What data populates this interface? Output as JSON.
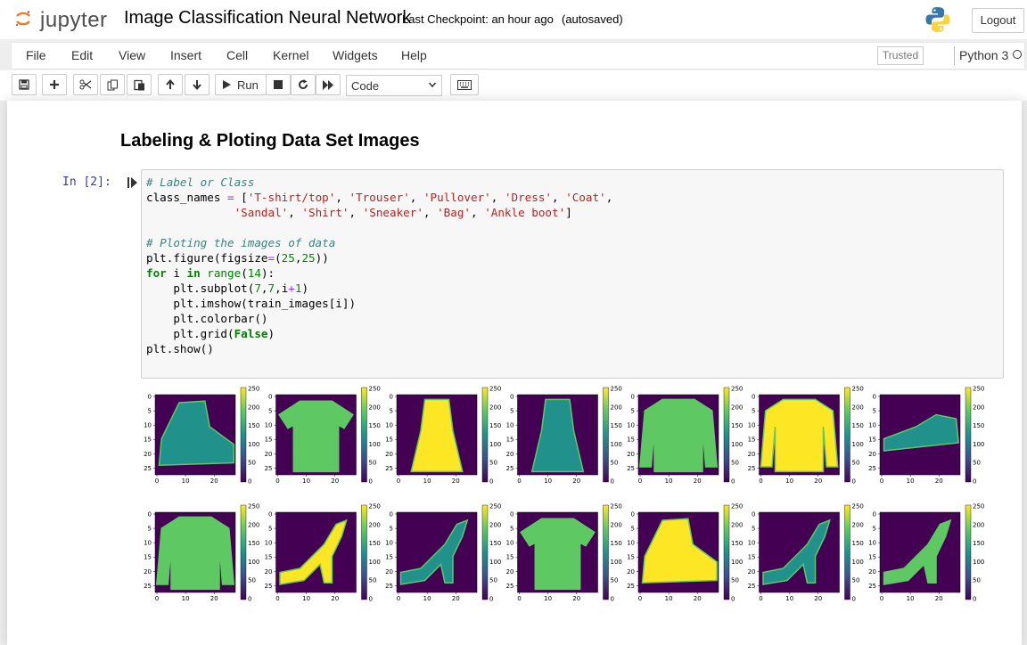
{
  "header": {
    "logo_text": "jupyter",
    "notebook_name": "Image Classification Neural Network",
    "checkpoint": "Last Checkpoint: an hour ago",
    "autosave": "(autosaved)",
    "logout_label": "Logout"
  },
  "menubar": {
    "items": [
      "File",
      "Edit",
      "View",
      "Insert",
      "Cell",
      "Kernel",
      "Widgets",
      "Help"
    ],
    "trusted_label": "Trusted",
    "kernel_name": "Python 3"
  },
  "toolbar": {
    "run_label": "Run",
    "cell_type": "Code",
    "icons": [
      "save-icon",
      "plus-icon",
      "cut-icon",
      "copy-icon",
      "paste-icon",
      "arrow-up-icon",
      "arrow-down-icon",
      "play-icon",
      "stop-icon",
      "restart-icon",
      "fast-forward-icon",
      "keyboard-icon"
    ]
  },
  "notebook": {
    "heading": "Labeling & Ploting Data Set Images",
    "prompt": "In [2]:",
    "code_lines": [
      "# Label or Class",
      "class_names = ['T-shirt/top', 'Trouser', 'Pullover', 'Dress', 'Coat',",
      "             'Sandal', 'Shirt', 'Sneaker', 'Bag', 'Ankle boot']",
      "",
      "# Ploting the images of data",
      "plt.figure(figsize=(25,25))",
      "for i in range(14):",
      "    plt.subplot(7,7,i+1)",
      "    plt.imshow(train_images[i])",
      "    plt.colorbar()",
      "    plt.grid(False)",
      "plt.show()"
    ]
  },
  "output": {
    "y_ticks": [
      "0",
      "5",
      "10",
      "15",
      "20",
      "25"
    ],
    "x_ticks": [
      "0",
      "10",
      "20"
    ],
    "colorbar_ticks": [
      "250",
      "200",
      "150",
      "100",
      "50",
      "0"
    ],
    "colormap": [
      "#440154",
      "#3b528b",
      "#21918c",
      "#5ec962",
      "#fde725"
    ],
    "images": [
      "ankle-boot",
      "t-shirt",
      "dress",
      "dress",
      "pullover",
      "pullover",
      "sneaker",
      "pullover",
      "sandal",
      "sandal",
      "t-shirt",
      "ankle-boot",
      "sandal",
      "sandal"
    ]
  }
}
